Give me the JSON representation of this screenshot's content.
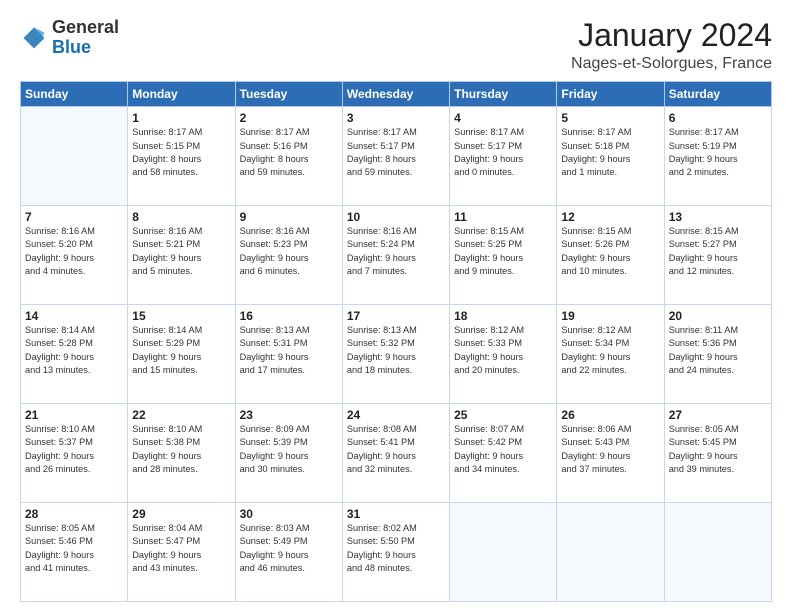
{
  "logo": {
    "general": "General",
    "blue": "Blue"
  },
  "header": {
    "month": "January 2024",
    "location": "Nages-et-Solorgues, France"
  },
  "days_of_week": [
    "Sunday",
    "Monday",
    "Tuesday",
    "Wednesday",
    "Thursday",
    "Friday",
    "Saturday"
  ],
  "weeks": [
    [
      {
        "day": "",
        "info": ""
      },
      {
        "day": "1",
        "info": "Sunrise: 8:17 AM\nSunset: 5:15 PM\nDaylight: 8 hours\nand 58 minutes."
      },
      {
        "day": "2",
        "info": "Sunrise: 8:17 AM\nSunset: 5:16 PM\nDaylight: 8 hours\nand 59 minutes."
      },
      {
        "day": "3",
        "info": "Sunrise: 8:17 AM\nSunset: 5:17 PM\nDaylight: 8 hours\nand 59 minutes."
      },
      {
        "day": "4",
        "info": "Sunrise: 8:17 AM\nSunset: 5:17 PM\nDaylight: 9 hours\nand 0 minutes."
      },
      {
        "day": "5",
        "info": "Sunrise: 8:17 AM\nSunset: 5:18 PM\nDaylight: 9 hours\nand 1 minute."
      },
      {
        "day": "6",
        "info": "Sunrise: 8:17 AM\nSunset: 5:19 PM\nDaylight: 9 hours\nand 2 minutes."
      }
    ],
    [
      {
        "day": "7",
        "info": "Sunrise: 8:16 AM\nSunset: 5:20 PM\nDaylight: 9 hours\nand 4 minutes."
      },
      {
        "day": "8",
        "info": "Sunrise: 8:16 AM\nSunset: 5:21 PM\nDaylight: 9 hours\nand 5 minutes."
      },
      {
        "day": "9",
        "info": "Sunrise: 8:16 AM\nSunset: 5:23 PM\nDaylight: 9 hours\nand 6 minutes."
      },
      {
        "day": "10",
        "info": "Sunrise: 8:16 AM\nSunset: 5:24 PM\nDaylight: 9 hours\nand 7 minutes."
      },
      {
        "day": "11",
        "info": "Sunrise: 8:15 AM\nSunset: 5:25 PM\nDaylight: 9 hours\nand 9 minutes."
      },
      {
        "day": "12",
        "info": "Sunrise: 8:15 AM\nSunset: 5:26 PM\nDaylight: 9 hours\nand 10 minutes."
      },
      {
        "day": "13",
        "info": "Sunrise: 8:15 AM\nSunset: 5:27 PM\nDaylight: 9 hours\nand 12 minutes."
      }
    ],
    [
      {
        "day": "14",
        "info": "Sunrise: 8:14 AM\nSunset: 5:28 PM\nDaylight: 9 hours\nand 13 minutes."
      },
      {
        "day": "15",
        "info": "Sunrise: 8:14 AM\nSunset: 5:29 PM\nDaylight: 9 hours\nand 15 minutes."
      },
      {
        "day": "16",
        "info": "Sunrise: 8:13 AM\nSunset: 5:31 PM\nDaylight: 9 hours\nand 17 minutes."
      },
      {
        "day": "17",
        "info": "Sunrise: 8:13 AM\nSunset: 5:32 PM\nDaylight: 9 hours\nand 18 minutes."
      },
      {
        "day": "18",
        "info": "Sunrise: 8:12 AM\nSunset: 5:33 PM\nDaylight: 9 hours\nand 20 minutes."
      },
      {
        "day": "19",
        "info": "Sunrise: 8:12 AM\nSunset: 5:34 PM\nDaylight: 9 hours\nand 22 minutes."
      },
      {
        "day": "20",
        "info": "Sunrise: 8:11 AM\nSunset: 5:36 PM\nDaylight: 9 hours\nand 24 minutes."
      }
    ],
    [
      {
        "day": "21",
        "info": "Sunrise: 8:10 AM\nSunset: 5:37 PM\nDaylight: 9 hours\nand 26 minutes."
      },
      {
        "day": "22",
        "info": "Sunrise: 8:10 AM\nSunset: 5:38 PM\nDaylight: 9 hours\nand 28 minutes."
      },
      {
        "day": "23",
        "info": "Sunrise: 8:09 AM\nSunset: 5:39 PM\nDaylight: 9 hours\nand 30 minutes."
      },
      {
        "day": "24",
        "info": "Sunrise: 8:08 AM\nSunset: 5:41 PM\nDaylight: 9 hours\nand 32 minutes."
      },
      {
        "day": "25",
        "info": "Sunrise: 8:07 AM\nSunset: 5:42 PM\nDaylight: 9 hours\nand 34 minutes."
      },
      {
        "day": "26",
        "info": "Sunrise: 8:06 AM\nSunset: 5:43 PM\nDaylight: 9 hours\nand 37 minutes."
      },
      {
        "day": "27",
        "info": "Sunrise: 8:05 AM\nSunset: 5:45 PM\nDaylight: 9 hours\nand 39 minutes."
      }
    ],
    [
      {
        "day": "28",
        "info": "Sunrise: 8:05 AM\nSunset: 5:46 PM\nDaylight: 9 hours\nand 41 minutes."
      },
      {
        "day": "29",
        "info": "Sunrise: 8:04 AM\nSunset: 5:47 PM\nDaylight: 9 hours\nand 43 minutes."
      },
      {
        "day": "30",
        "info": "Sunrise: 8:03 AM\nSunset: 5:49 PM\nDaylight: 9 hours\nand 46 minutes."
      },
      {
        "day": "31",
        "info": "Sunrise: 8:02 AM\nSunset: 5:50 PM\nDaylight: 9 hours\nand 48 minutes."
      },
      {
        "day": "",
        "info": ""
      },
      {
        "day": "",
        "info": ""
      },
      {
        "day": "",
        "info": ""
      }
    ]
  ]
}
